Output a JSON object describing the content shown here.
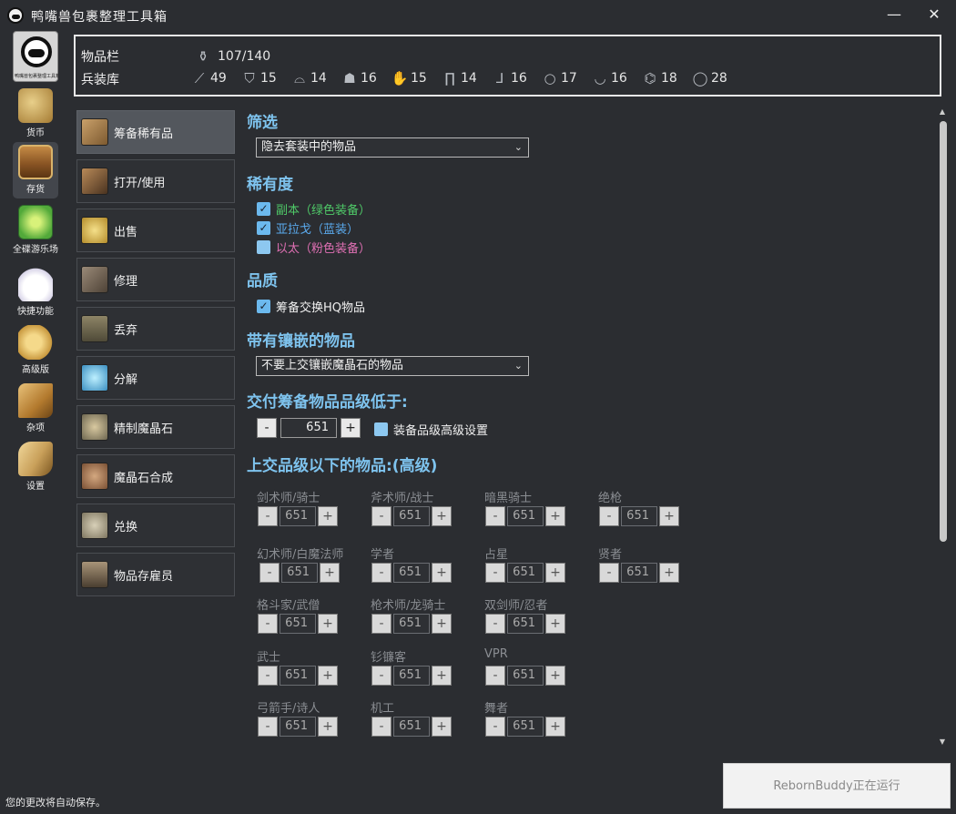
{
  "window": {
    "title": "鸭嘴兽包裹整理工具箱",
    "minimize": "—",
    "close": "✕"
  },
  "logo": {
    "text": "鸭嘴兽包裹整理工具箱"
  },
  "nav": [
    {
      "label": "货币",
      "icon": "coins-bag-icon"
    },
    {
      "label": "存货",
      "icon": "treasure-chest-icon"
    },
    {
      "label": "全碟游乐场",
      "icon": "gold-saucer-icon"
    },
    {
      "label": "快捷功能",
      "icon": "moogle-icon"
    },
    {
      "label": "高级版",
      "icon": "chocobo-icon"
    },
    {
      "label": "杂项",
      "icon": "misc-scroll-icon"
    },
    {
      "label": "设置",
      "icon": "settings-quill-icon"
    }
  ],
  "inventory": {
    "bag_label": "物品栏",
    "bag_value": "107/140",
    "armory_label": "兵装库",
    "armory": [
      {
        "icon": "main-hand-icon",
        "count": "49"
      },
      {
        "icon": "off-hand-icon",
        "count": "15"
      },
      {
        "icon": "head-icon",
        "count": "14"
      },
      {
        "icon": "body-icon",
        "count": "16"
      },
      {
        "icon": "hands-icon",
        "count": "15"
      },
      {
        "icon": "legs-icon",
        "count": "14"
      },
      {
        "icon": "feet-icon",
        "count": "16"
      },
      {
        "icon": "earring-icon",
        "count": "17"
      },
      {
        "icon": "necklace-icon",
        "count": "16"
      },
      {
        "icon": "bracelet-icon",
        "count": "18"
      },
      {
        "icon": "ring-icon",
        "count": "28"
      }
    ]
  },
  "categories": [
    {
      "label": "筹备稀有品",
      "active": true
    },
    {
      "label": "打开/使用"
    },
    {
      "label": "出售"
    },
    {
      "label": "修理"
    },
    {
      "label": "丢弃"
    },
    {
      "label": "分解"
    },
    {
      "label": "精制魔晶石"
    },
    {
      "label": "魔晶石合成"
    },
    {
      "label": "兑换"
    },
    {
      "label": "物品存雇员"
    }
  ],
  "filter": {
    "title": "筛选",
    "value": "隐去套装中的物品"
  },
  "rarity": {
    "title": "稀有度",
    "items": [
      {
        "label": "副本（绿色装备）",
        "checked": true,
        "color": "#4fc968"
      },
      {
        "label": "亚拉戈（蓝装）",
        "checked": true,
        "color": "#5aa9ec"
      },
      {
        "label": "以太（粉色装备）",
        "checked": false,
        "color": "#e070b4"
      }
    ]
  },
  "quality": {
    "title": "品质",
    "hq_label": "筹备交换HQ物品",
    "hq_checked": true
  },
  "materia": {
    "title": "带有镶嵌的物品",
    "value": "不要上交镶嵌魔晶石的物品"
  },
  "ilvl": {
    "title": "交付筹备物品品级低于:",
    "minus": "-",
    "value": "651",
    "plus": "+",
    "advanced_label": "装备品级高级设置",
    "advanced_checked": false
  },
  "advanced": {
    "title": "上交品级以下的物品:(高级)",
    "jobs": [
      {
        "label": "剑术师/骑士",
        "value": "651"
      },
      {
        "label": "斧术师/战士",
        "value": "651"
      },
      {
        "label": "暗黑骑士",
        "value": "651"
      },
      {
        "label": "绝枪",
        "value": "651"
      },
      {
        "label": "幻术师/白魔法师",
        "value": "651"
      },
      {
        "label": "学者",
        "value": "651"
      },
      {
        "label": "占星",
        "value": "651"
      },
      {
        "label": "贤者",
        "value": "651"
      },
      {
        "label": "格斗家/武僧",
        "value": "651"
      },
      {
        "label": "枪术师/龙骑士",
        "value": "651"
      },
      {
        "label": "双剑师/忍者",
        "value": "651"
      },
      {
        "label": "武士",
        "value": "651"
      },
      {
        "label": "钐镰客",
        "value": "651"
      },
      {
        "label": "VPR",
        "value": "651"
      },
      {
        "label": "弓箭手/诗人",
        "value": "651"
      },
      {
        "label": "机工",
        "value": "651"
      },
      {
        "label": "舞者",
        "value": "651"
      }
    ]
  },
  "status": {
    "text": "您的更改将自动保存。",
    "run_button": "RebornBuddy正在运行"
  }
}
